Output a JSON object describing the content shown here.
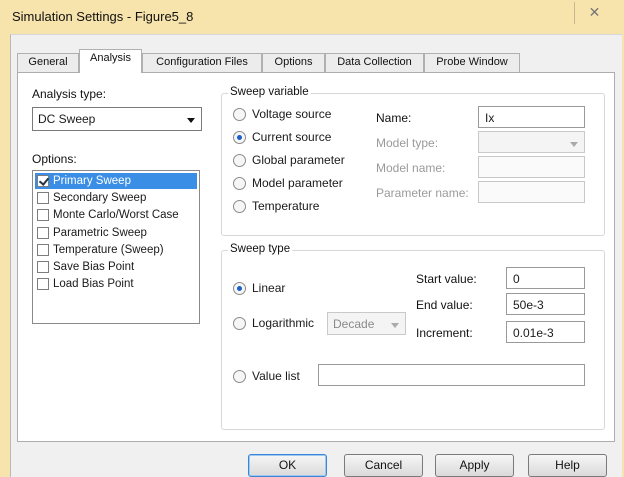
{
  "window": {
    "title": "Simulation Settings - Figure5_8",
    "close_label": "✕"
  },
  "tabs": [
    {
      "label": "General"
    },
    {
      "label": "Analysis",
      "active": true
    },
    {
      "label": "Configuration Files"
    },
    {
      "label": "Options"
    },
    {
      "label": "Data Collection"
    },
    {
      "label": "Probe Window"
    }
  ],
  "analysis": {
    "type_label": "Analysis type:",
    "type_value": "DC Sweep",
    "options_label": "Options:",
    "options": [
      {
        "label": "Primary Sweep",
        "checked": true,
        "selected": true
      },
      {
        "label": "Secondary Sweep",
        "checked": false
      },
      {
        "label": "Monte Carlo/Worst Case",
        "checked": false
      },
      {
        "label": "Parametric Sweep",
        "checked": false
      },
      {
        "label": "Temperature (Sweep)",
        "checked": false
      },
      {
        "label": "Save Bias Point",
        "checked": false
      },
      {
        "label": "Load Bias Point",
        "checked": false
      }
    ]
  },
  "sweep_variable": {
    "title": "Sweep variable",
    "options": [
      {
        "label": "Voltage source",
        "selected": false
      },
      {
        "label": "Current source",
        "selected": true
      },
      {
        "label": "Global parameter",
        "selected": false
      },
      {
        "label": "Model parameter",
        "selected": false
      },
      {
        "label": "Temperature",
        "selected": false
      }
    ],
    "name_label": "Name:",
    "name_value": "Ix",
    "model_type_label": "Model type:",
    "model_type_value": "",
    "model_name_label": "Model name:",
    "model_name_value": "",
    "parameter_name_label": "Parameter name:",
    "parameter_name_value": ""
  },
  "sweep_type": {
    "title": "Sweep type",
    "linear_label": "Linear",
    "linear_selected": true,
    "logarithmic_label": "Logarithmic",
    "logarithmic_selected": false,
    "log_scale_value": "Decade",
    "value_list_label": "Value list",
    "value_list_selected": false,
    "value_list_value": "",
    "start_label": "Start value:",
    "start_value": "0",
    "end_label": "End value:",
    "end_value": "50e-3",
    "increment_label": "Increment:",
    "increment_value": "0.01e-3"
  },
  "buttons": {
    "ok": "OK",
    "cancel": "Cancel",
    "apply": "Apply",
    "help": "Help"
  },
  "colors": {
    "window_frame": "#f7e3ac",
    "selection": "#3a8ee6",
    "radio_dot": "#1d5fc9"
  }
}
